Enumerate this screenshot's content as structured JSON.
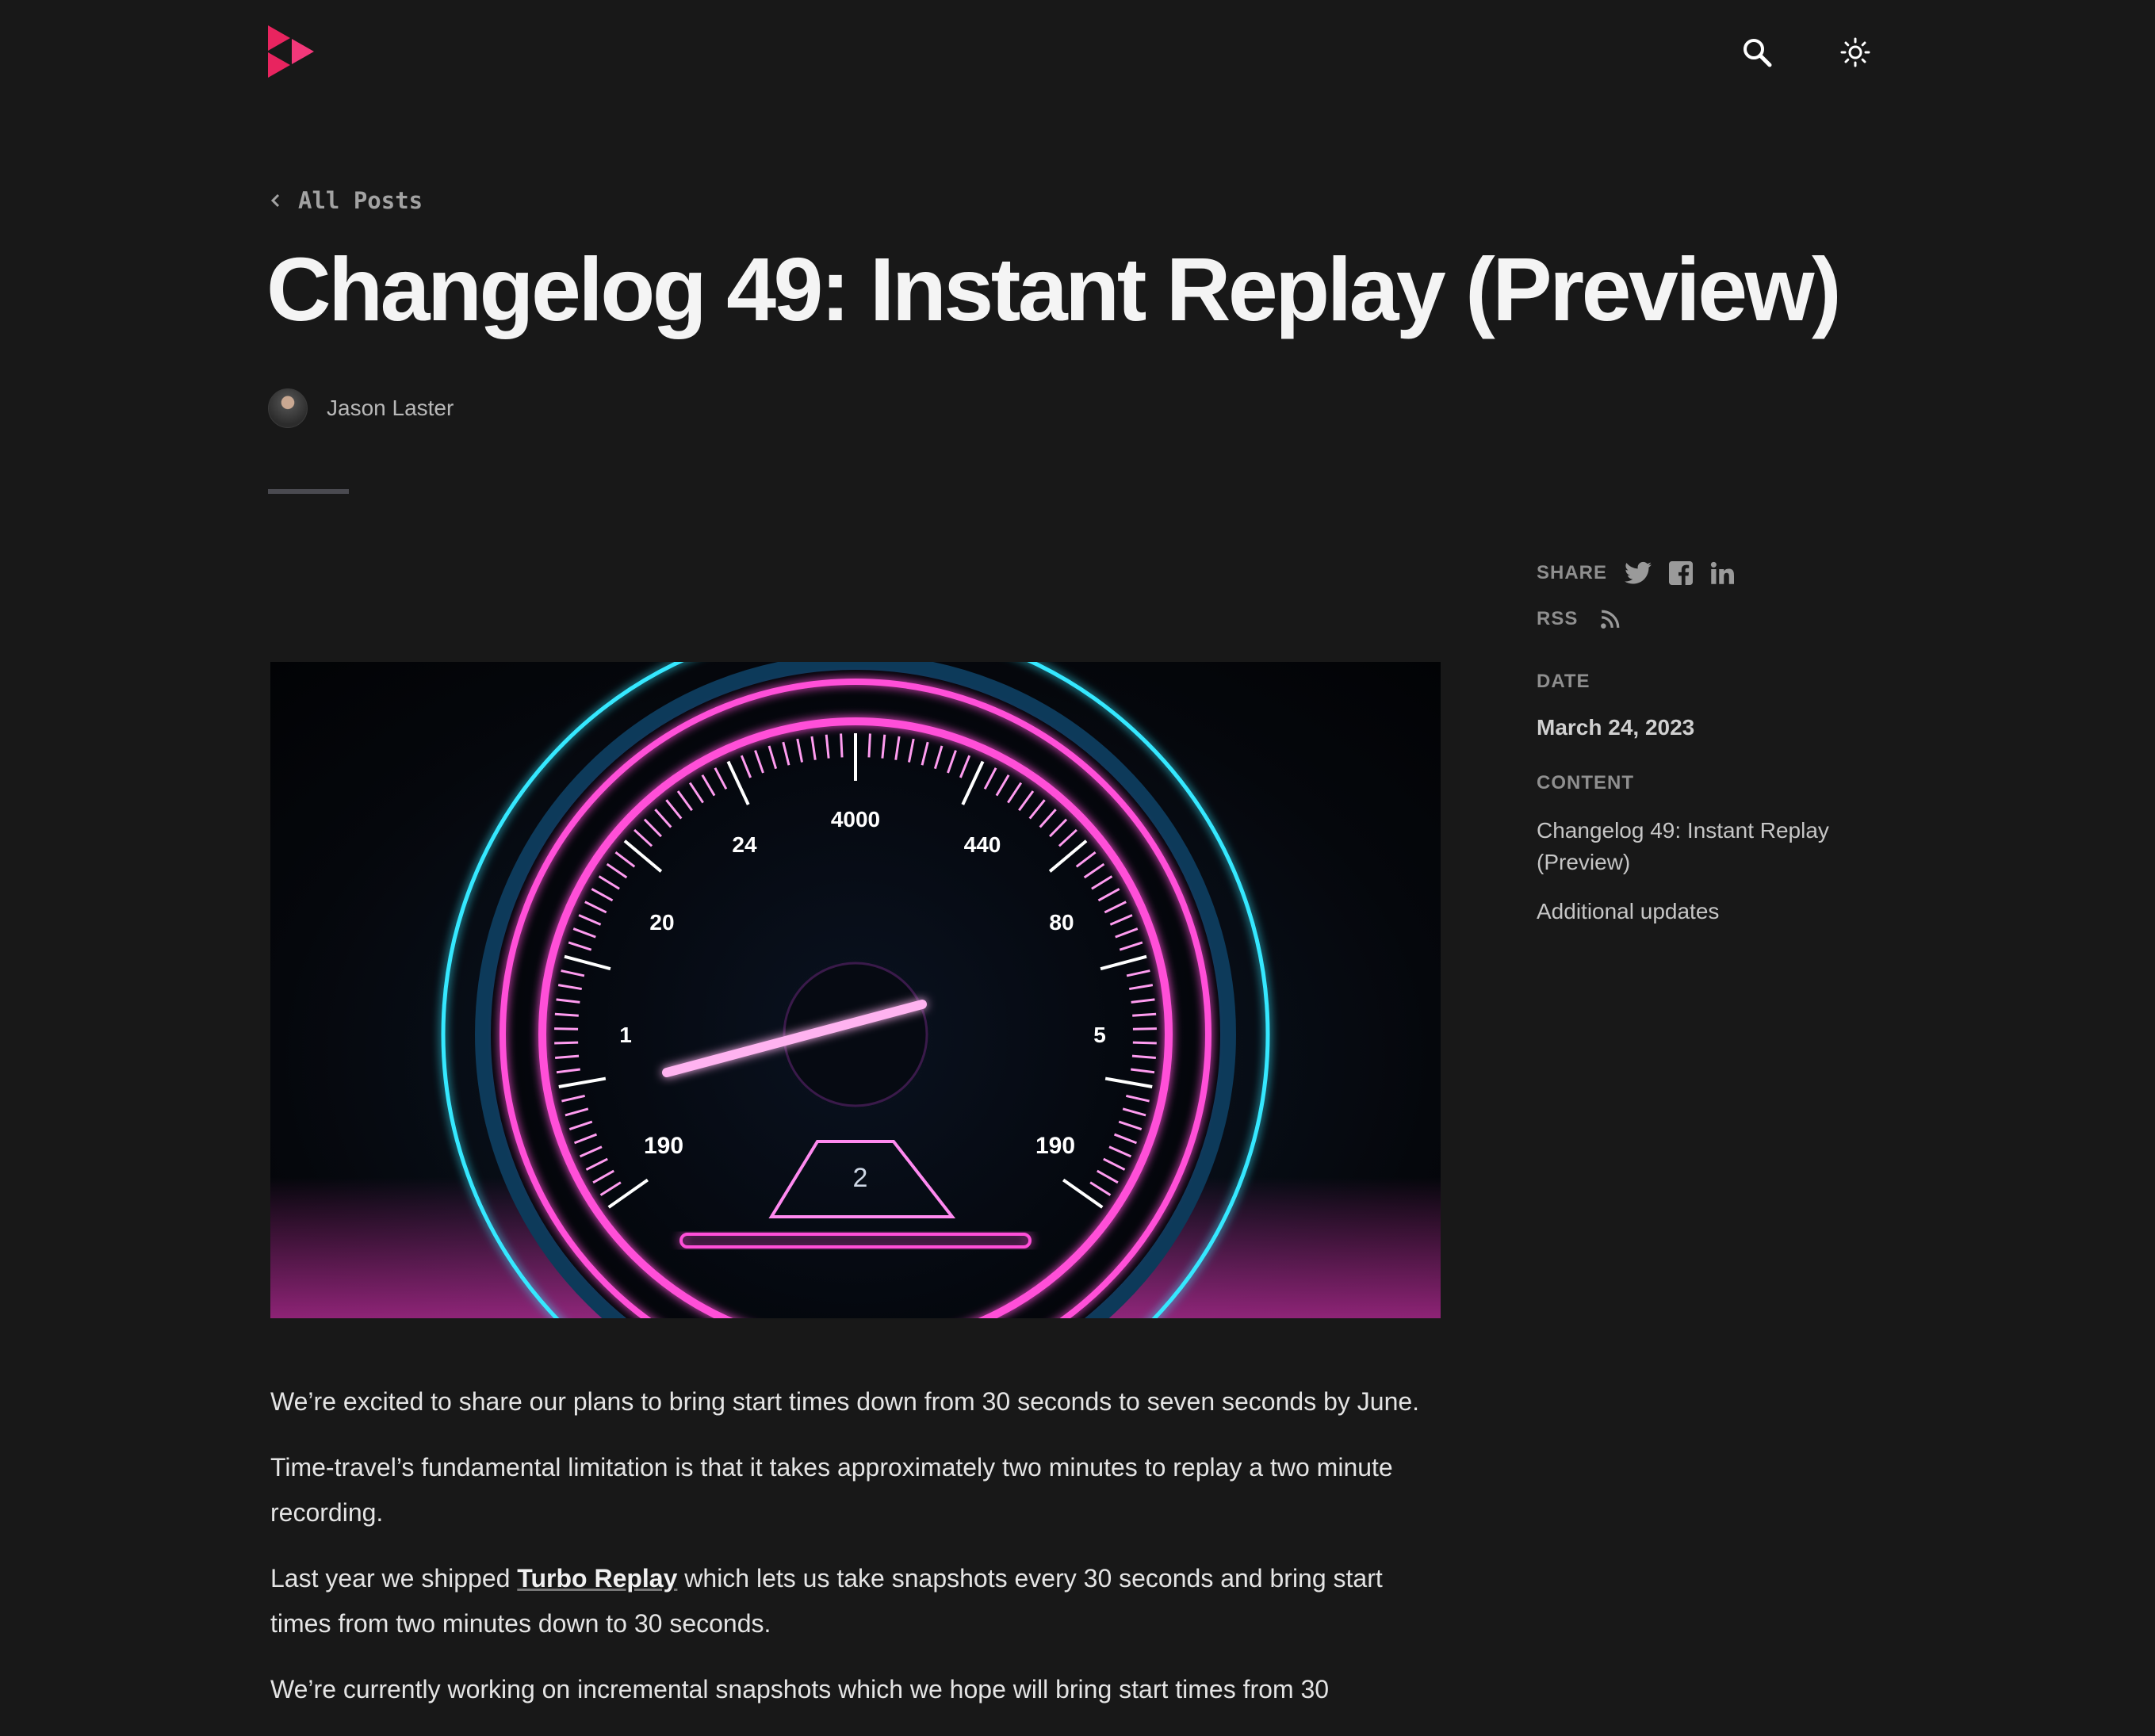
{
  "header": {
    "logo_colors": [
      "#e8245f",
      "#f2387a"
    ]
  },
  "back_link": {
    "label": "All Posts"
  },
  "post": {
    "title": "Changelog 49: Instant Replay (Preview)",
    "author": "Jason Laster"
  },
  "sidebar": {
    "share_label": "SHARE",
    "rss_label": "RSS",
    "date_label": "DATE",
    "date_value": "March 24, 2023",
    "content_label": "CONTENT",
    "toc": [
      "Changelog 49: Instant Replay (Preview)",
      "Additional updates"
    ]
  },
  "hero": {
    "gauge_labels": [
      "4000",
      "24",
      "440",
      "20",
      "80",
      "1",
      "5",
      "190",
      "190",
      "2"
    ],
    "accent_pink": "#ff3ccf",
    "accent_cyan": "#35e8ff"
  },
  "article": {
    "p1": "We’re excited to share our plans to bring start times down from 30 seconds to seven seconds by June.",
    "p2": "Time-travel’s fundamental limitation is that it takes approximately two minutes to replay a two minute recording.",
    "p3_before": "Last year we shipped ",
    "p3_link": "Turbo Replay",
    "p3_after": " which lets us take snapshots every 30 seconds and bring start times from two minutes down to 30 seconds.",
    "p4": "We’re currently working on incremental snapshots which we hope will bring start times from 30"
  }
}
